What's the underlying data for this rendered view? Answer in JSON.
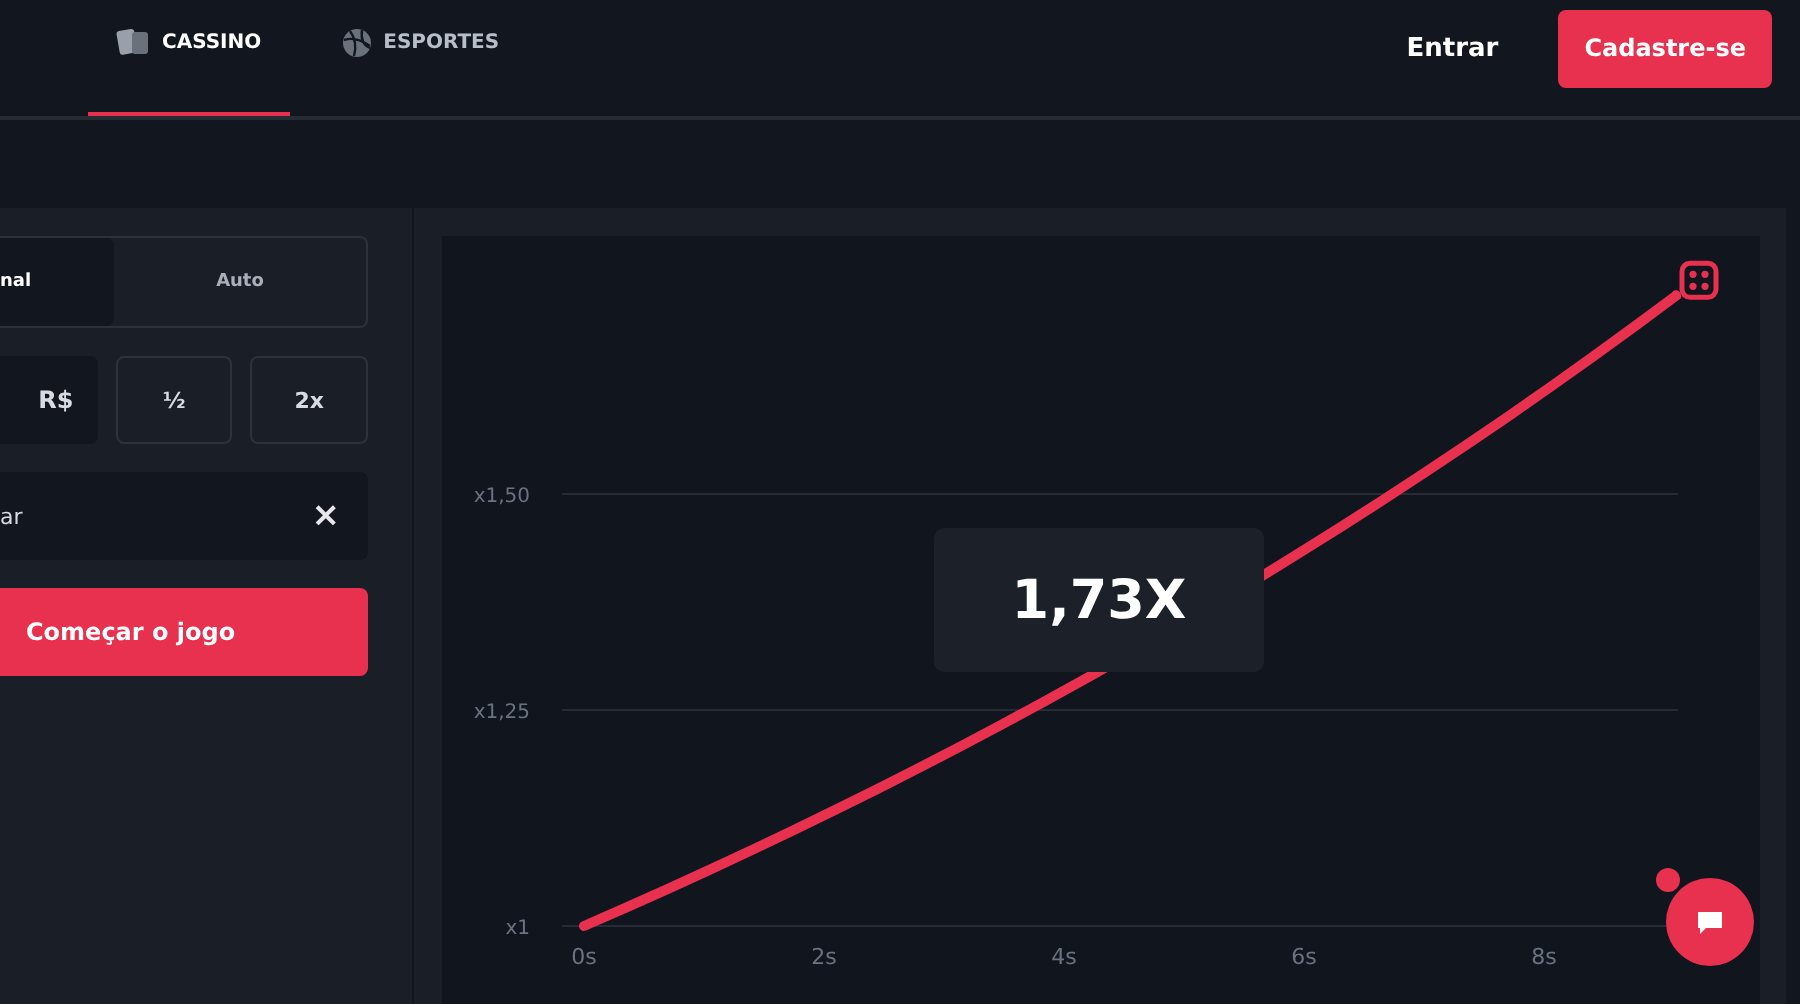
{
  "nav": {
    "tabs": [
      {
        "label": "CASSINO",
        "kind": "cards",
        "selected": true
      },
      {
        "label": "ESPORTES",
        "kind": "ball",
        "selected": false
      }
    ],
    "login": "Entrar",
    "signup": "Cadastre-se"
  },
  "bet_panel": {
    "modes": [
      {
        "label": "nal",
        "selected": true
      },
      {
        "label": "Auto",
        "selected": false
      }
    ],
    "currency": "R$",
    "half": "½",
    "double": "2x",
    "auto_field": "ar",
    "clear": "×",
    "start": "Começar o jogo"
  },
  "game": {
    "multiplier": "1,73X",
    "chart": {
      "x_labels": [
        "0s",
        "2s",
        "4s",
        "6s",
        "8s"
      ],
      "y_labels": [
        "x1,50",
        "x1,25",
        "x1"
      ]
    }
  }
}
